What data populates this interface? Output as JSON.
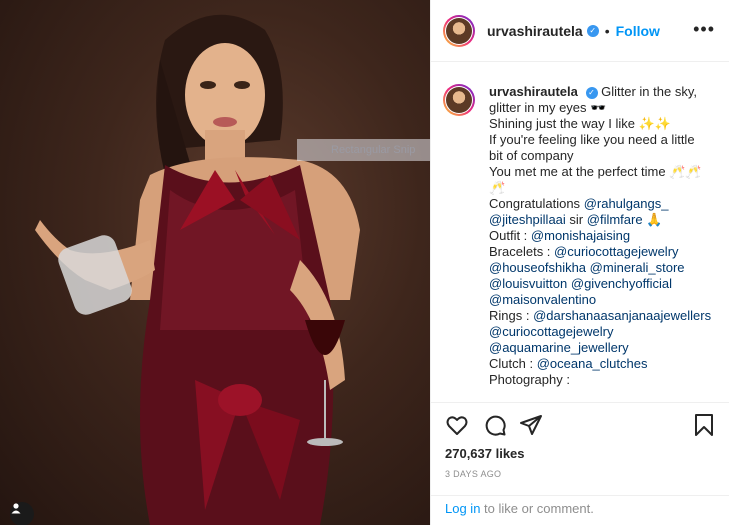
{
  "post": {
    "username": "urvashirautela",
    "follow_label": "Follow",
    "separator": "•",
    "more_label": "•••"
  },
  "snip_hint": "Rectangular Snip",
  "caption": {
    "username": "urvashirautela",
    "line1": "Glitter in the sky,",
    "line2": "glitter in my eyes 🕶️",
    "line3": "Shining just the way I like ✨✨",
    "line4": "If you're feeling like you need a little",
    "line5": "bit of company",
    "line6": "You met me at the perfect time 🥂🥂",
    "line7": "🥂",
    "congrats_prefix": "Congratulations",
    "mention_rahul": "@rahulgangs_",
    "mention_jitesh": "@jiteshpillaai",
    "sir_text": "sir",
    "mention_filmfare": "@filmfare",
    "filmfare_emoji": "🙏",
    "outfit_label": "Outfit :",
    "outfit_mention": "@monishajaising",
    "bracelets_label": "Bracelets :",
    "bracelets_mention1": "@curiocottagejewelry",
    "bracelets_mention2": "@houseofshikha",
    "bracelets_mention3": "@minerali_store",
    "bracelets_mention4": "@louisvuitton",
    "bracelets_mention5": "@givenchyofficial",
    "bracelets_mention6": "@maisonvalentino",
    "rings_label": "Rings :",
    "rings_mention1": "@darshanaasanjanaajewellers",
    "rings_mention2": "@curiocottagejewelry",
    "rings_mention3": "@aquamarine_jewellery",
    "clutch_label": "Clutch :",
    "clutch_mention": "@oceana_clutches",
    "photography_label": "Photography :"
  },
  "stats": {
    "likes": "270,637 likes",
    "time_ago": "3 DAYS AGO"
  },
  "login": {
    "link": "Log in",
    "suffix": "to like or comment."
  },
  "colors": {
    "accent": "#0095f6",
    "verified": "#3897f0",
    "mention": "#00376b"
  },
  "icons": [
    "heart-icon",
    "comment-icon",
    "share-icon",
    "bookmark-icon",
    "more-icon",
    "verified-icon",
    "user-icon"
  ]
}
